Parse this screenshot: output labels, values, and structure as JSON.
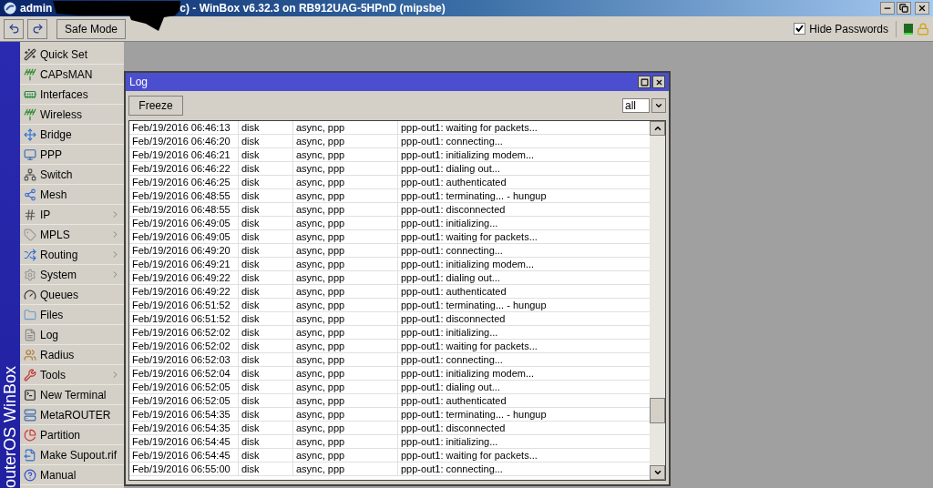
{
  "window": {
    "title_parts": [
      "admin",
      "c) - WinBox v6.32.3 on RB912UAG-5HPnD (mipsbe)"
    ]
  },
  "toolbar": {
    "safe_mode": "Safe Mode",
    "hide_passwords": {
      "label": "Hide Passwords",
      "checked": true
    }
  },
  "sidebar": {
    "brand": "outerOS WinBox",
    "items": [
      {
        "label": "Quick Set",
        "submenu": false
      },
      {
        "label": "CAPsMAN",
        "submenu": false
      },
      {
        "label": "Interfaces",
        "submenu": false
      },
      {
        "label": "Wireless",
        "submenu": false
      },
      {
        "label": "Bridge",
        "submenu": false
      },
      {
        "label": "PPP",
        "submenu": false
      },
      {
        "label": "Switch",
        "submenu": false
      },
      {
        "label": "Mesh",
        "submenu": false
      },
      {
        "label": "IP",
        "submenu": true
      },
      {
        "label": "MPLS",
        "submenu": true
      },
      {
        "label": "Routing",
        "submenu": true
      },
      {
        "label": "System",
        "submenu": true
      },
      {
        "label": "Queues",
        "submenu": false
      },
      {
        "label": "Files",
        "submenu": false
      },
      {
        "label": "Log",
        "submenu": false
      },
      {
        "label": "Radius",
        "submenu": false
      },
      {
        "label": "Tools",
        "submenu": true
      },
      {
        "label": "New Terminal",
        "submenu": false
      },
      {
        "label": "MetaROUTER",
        "submenu": false
      },
      {
        "label": "Partition",
        "submenu": false
      },
      {
        "label": "Make Supout.rif",
        "submenu": false
      },
      {
        "label": "Manual",
        "submenu": false
      }
    ]
  },
  "log_window": {
    "title": "Log",
    "freeze": "Freeze",
    "filter": "all",
    "rows": [
      {
        "time": "Feb/19/2016 06:46:13",
        "column_2": "disk",
        "column_3": "async, ppp",
        "message": "ppp-out1: waiting for packets..."
      },
      {
        "time": "Feb/19/2016 06:46:20",
        "column_2": "disk",
        "column_3": "async, ppp",
        "message": "ppp-out1: connecting..."
      },
      {
        "time": "Feb/19/2016 06:46:21",
        "column_2": "disk",
        "column_3": "async, ppp",
        "message": "ppp-out1: initializing modem..."
      },
      {
        "time": "Feb/19/2016 06:46:22",
        "column_2": "disk",
        "column_3": "async, ppp",
        "message": "ppp-out1: dialing out..."
      },
      {
        "time": "Feb/19/2016 06:46:25",
        "column_2": "disk",
        "column_3": "async, ppp",
        "message": "ppp-out1: authenticated"
      },
      {
        "time": "Feb/19/2016 06:48:55",
        "column_2": "disk",
        "column_3": "async, ppp",
        "message": "ppp-out1: terminating... - hungup"
      },
      {
        "time": "Feb/19/2016 06:48:55",
        "column_2": "disk",
        "column_3": "async, ppp",
        "message": "ppp-out1: disconnected"
      },
      {
        "time": "Feb/19/2016 06:49:05",
        "column_2": "disk",
        "column_3": "async, ppp",
        "message": "ppp-out1: initializing..."
      },
      {
        "time": "Feb/19/2016 06:49:05",
        "column_2": "disk",
        "column_3": "async, ppp",
        "message": "ppp-out1: waiting for packets..."
      },
      {
        "time": "Feb/19/2016 06:49:20",
        "column_2": "disk",
        "column_3": "async, ppp",
        "message": "ppp-out1: connecting..."
      },
      {
        "time": "Feb/19/2016 06:49:21",
        "column_2": "disk",
        "column_3": "async, ppp",
        "message": "ppp-out1: initializing modem..."
      },
      {
        "time": "Feb/19/2016 06:49:22",
        "column_2": "disk",
        "column_3": "async, ppp",
        "message": "ppp-out1: dialing out..."
      },
      {
        "time": "Feb/19/2016 06:49:22",
        "column_2": "disk",
        "column_3": "async, ppp",
        "message": "ppp-out1: authenticated"
      },
      {
        "time": "Feb/19/2016 06:51:52",
        "column_2": "disk",
        "column_3": "async, ppp",
        "message": "ppp-out1: terminating... - hungup"
      },
      {
        "time": "Feb/19/2016 06:51:52",
        "column_2": "disk",
        "column_3": "async, ppp",
        "message": "ppp-out1: disconnected"
      },
      {
        "time": "Feb/19/2016 06:52:02",
        "column_2": "disk",
        "column_3": "async, ppp",
        "message": "ppp-out1: initializing..."
      },
      {
        "time": "Feb/19/2016 06:52:02",
        "column_2": "disk",
        "column_3": "async, ppp",
        "message": "ppp-out1: waiting for packets..."
      },
      {
        "time": "Feb/19/2016 06:52:03",
        "column_2": "disk",
        "column_3": "async, ppp",
        "message": "ppp-out1: connecting..."
      },
      {
        "time": "Feb/19/2016 06:52:04",
        "column_2": "disk",
        "column_3": "async, ppp",
        "message": "ppp-out1: initializing modem..."
      },
      {
        "time": "Feb/19/2016 06:52:05",
        "column_2": "disk",
        "column_3": "async, ppp",
        "message": "ppp-out1: dialing out..."
      },
      {
        "time": "Feb/19/2016 06:52:05",
        "column_2": "disk",
        "column_3": "async, ppp",
        "message": "ppp-out1: authenticated"
      },
      {
        "time": "Feb/19/2016 06:54:35",
        "column_2": "disk",
        "column_3": "async, ppp",
        "message": "ppp-out1: terminating... - hungup"
      },
      {
        "time": "Feb/19/2016 06:54:35",
        "column_2": "disk",
        "column_3": "async, ppp",
        "message": "ppp-out1: disconnected"
      },
      {
        "time": "Feb/19/2016 06:54:45",
        "column_2": "disk",
        "column_3": "async, ppp",
        "message": "ppp-out1: initializing..."
      },
      {
        "time": "Feb/19/2016 06:54:45",
        "column_2": "disk",
        "column_3": "async, ppp",
        "message": "ppp-out1: waiting for packets..."
      },
      {
        "time": "Feb/19/2016 06:55:00",
        "column_2": "disk",
        "column_3": "async, ppp",
        "message": "ppp-out1: connecting..."
      }
    ]
  }
}
